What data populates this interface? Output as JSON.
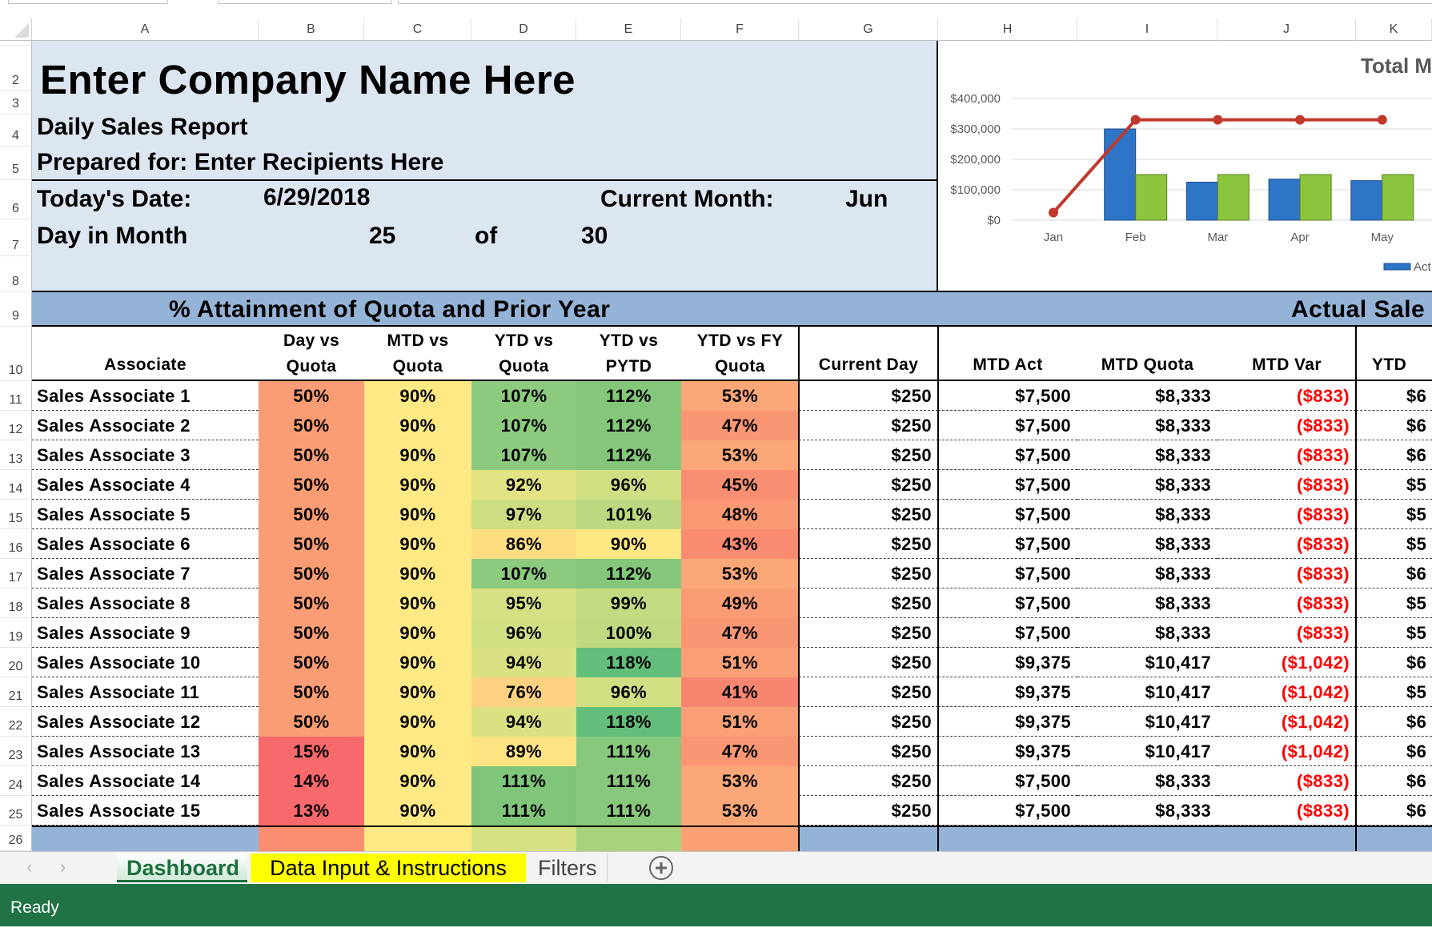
{
  "columns": [
    "A",
    "B",
    "C",
    "D",
    "E",
    "F",
    "G",
    "H",
    "I",
    "J",
    "K"
  ],
  "header": {
    "company": "Enter Company Name Here",
    "report": "Daily Sales Report",
    "prepared": "Prepared for: Enter Recipients Here",
    "date_label": "Today's Date:",
    "date_value": "6/29/2018",
    "month_label": "Current Month:",
    "month_value": "Jun",
    "day_label": "Day in Month",
    "day_value": "25",
    "of_label": "of",
    "days_total": "30"
  },
  "bands": {
    "attainment": "% Attainment of Quota and Prior Year",
    "actual": "Actual Sale"
  },
  "table_headers": {
    "associate": "Associate",
    "b": [
      "Day vs",
      "Quota"
    ],
    "c": [
      "MTD vs",
      "Quota"
    ],
    "d": [
      "YTD vs",
      "Quota"
    ],
    "e": [
      "YTD vs",
      "PYTD"
    ],
    "f": [
      "YTD vs FY",
      "Quota"
    ],
    "current_day": "Current Day",
    "mtd_act": "MTD Act",
    "mtd_quota": "MTD Quota",
    "mtd_var": "MTD Var",
    "ytd": "YTD"
  },
  "rows": [
    {
      "n": "11",
      "name": "Sales Associate 1",
      "pct": [
        "50%",
        "90%",
        "107%",
        "112%",
        "53%"
      ],
      "colors": [
        "#fa9d75",
        "#ffe984",
        "#8ccb7d",
        "#84c77b",
        "#fba777"
      ],
      "cur": "$250",
      "act": "$7,500",
      "quota": "$8,333",
      "var": "($833)",
      "ytd": "$6"
    },
    {
      "n": "12",
      "name": "Sales Associate 2",
      "pct": [
        "50%",
        "90%",
        "107%",
        "112%",
        "47%"
      ],
      "colors": [
        "#fa9d75",
        "#ffe984",
        "#8ccb7d",
        "#84c77b",
        "#fa9673"
      ],
      "cur": "$250",
      "act": "$7,500",
      "quota": "$8,333",
      "var": "($833)",
      "ytd": "$6"
    },
    {
      "n": "13",
      "name": "Sales Associate 3",
      "pct": [
        "50%",
        "90%",
        "107%",
        "112%",
        "53%"
      ],
      "colors": [
        "#fa9d75",
        "#ffe984",
        "#8ccb7d",
        "#84c77b",
        "#fba777"
      ],
      "cur": "$250",
      "act": "$7,500",
      "quota": "$8,333",
      "var": "($833)",
      "ytd": "$6"
    },
    {
      "n": "14",
      "name": "Sales Associate 4",
      "pct": [
        "50%",
        "90%",
        "92%",
        "96%",
        "45%"
      ],
      "colors": [
        "#fa9d75",
        "#ffe984",
        "#e2e383",
        "#d1df82",
        "#f98f72"
      ],
      "cur": "$250",
      "act": "$7,500",
      "quota": "$8,333",
      "var": "($833)",
      "ytd": "$5"
    },
    {
      "n": "15",
      "name": "Sales Associate 5",
      "pct": [
        "50%",
        "90%",
        "97%",
        "101%",
        "48%"
      ],
      "colors": [
        "#fa9d75",
        "#ffe984",
        "#cddd81",
        "#bcd880",
        "#fa9973"
      ],
      "cur": "$250",
      "act": "$7,500",
      "quota": "$8,333",
      "var": "($833)",
      "ytd": "$5"
    },
    {
      "n": "16",
      "name": "Sales Associate 6",
      "pct": [
        "50%",
        "90%",
        "86%",
        "90%",
        "43%"
      ],
      "colors": [
        "#fa9d75",
        "#ffe984",
        "#fedd81",
        "#fee883",
        "#f98b71"
      ],
      "cur": "$250",
      "act": "$7,500",
      "quota": "$8,333",
      "var": "($833)",
      "ytd": "$5"
    },
    {
      "n": "17",
      "name": "Sales Associate 7",
      "pct": [
        "50%",
        "90%",
        "107%",
        "112%",
        "53%"
      ],
      "colors": [
        "#fa9d75",
        "#ffe984",
        "#8ccb7d",
        "#84c77b",
        "#fba777"
      ],
      "cur": "$250",
      "act": "$7,500",
      "quota": "$8,333",
      "var": "($833)",
      "ytd": "$6"
    },
    {
      "n": "18",
      "name": "Sales Associate 8",
      "pct": [
        "50%",
        "90%",
        "95%",
        "99%",
        "49%"
      ],
      "colors": [
        "#fa9d75",
        "#ffe984",
        "#d6e082",
        "#c4da80",
        "#fa9c74"
      ],
      "cur": "$250",
      "act": "$7,500",
      "quota": "$8,333",
      "var": "($833)",
      "ytd": "$5"
    },
    {
      "n": "19",
      "name": "Sales Associate 9",
      "pct": [
        "50%",
        "90%",
        "96%",
        "100%",
        "47%"
      ],
      "colors": [
        "#fa9d75",
        "#ffe984",
        "#d1df82",
        "#c0d980",
        "#fa9673"
      ],
      "cur": "$250",
      "act": "$7,500",
      "quota": "$8,333",
      "var": "($833)",
      "ytd": "$5"
    },
    {
      "n": "20",
      "name": "Sales Associate 10",
      "pct": [
        "50%",
        "90%",
        "94%",
        "118%",
        "51%"
      ],
      "colors": [
        "#fa9d75",
        "#ffe984",
        "#dae182",
        "#63be7b",
        "#fba076"
      ],
      "cur": "$250",
      "act": "$9,375",
      "quota": "$10,417",
      "var": "($1,042)",
      "ytd": "$6"
    },
    {
      "n": "21",
      "name": "Sales Associate 11",
      "pct": [
        "50%",
        "90%",
        "76%",
        "96%",
        "41%"
      ],
      "colors": [
        "#fa9d75",
        "#ffe984",
        "#fed280",
        "#d1df82",
        "#f88570"
      ],
      "cur": "$250",
      "act": "$9,375",
      "quota": "$10,417",
      "var": "($1,042)",
      "ytd": "$5"
    },
    {
      "n": "22",
      "name": "Sales Associate 12",
      "pct": [
        "50%",
        "90%",
        "94%",
        "118%",
        "51%"
      ],
      "colors": [
        "#fa9d75",
        "#ffe984",
        "#dae182",
        "#63be7b",
        "#fba076"
      ],
      "cur": "$250",
      "act": "$9,375",
      "quota": "$10,417",
      "var": "($1,042)",
      "ytd": "$6"
    },
    {
      "n": "23",
      "name": "Sales Associate 13",
      "pct": [
        "15%",
        "90%",
        "89%",
        "111%",
        "47%"
      ],
      "colors": [
        "#f8696b",
        "#ffe984",
        "#fee382",
        "#88c87c",
        "#fa9673"
      ],
      "cur": "$250",
      "act": "$9,375",
      "quota": "$10,417",
      "var": "($1,042)",
      "ytd": "$6"
    },
    {
      "n": "24",
      "name": "Sales Associate 14",
      "pct": [
        "14%",
        "90%",
        "111%",
        "111%",
        "53%"
      ],
      "colors": [
        "#f8696b",
        "#ffe984",
        "#7fc57a",
        "#88c87c",
        "#fba777"
      ],
      "cur": "$250",
      "act": "$7,500",
      "quota": "$8,333",
      "var": "($833)",
      "ytd": "$6"
    },
    {
      "n": "25",
      "name": "Sales Associate 15",
      "pct": [
        "13%",
        "90%",
        "111%",
        "111%",
        "53%"
      ],
      "colors": [
        "#f8696b",
        "#ffe984",
        "#7fc57a",
        "#88c87c",
        "#fba777"
      ],
      "cur": "$250",
      "act": "$7,500",
      "quota": "$8,333",
      "var": "($833)",
      "ytd": "$6"
    }
  ],
  "total_row_colors": [
    "#f98d70",
    "#ffe984",
    "#d6e082",
    "#a8d27e",
    "#fba174"
  ],
  "colors": {
    "header_bg": "#dce6f1",
    "band": "#95b3d7",
    "negative": "#ff0000",
    "status_bar": "#217346",
    "active_tab": "#1e6f3e",
    "highlight_tab": "#ffff00"
  },
  "chart_data": {
    "type": "bar",
    "title": "Total M",
    "categories": [
      "Jan",
      "Feb",
      "Mar",
      "Apr",
      "May"
    ],
    "yticks": [
      "$0",
      "$100,000",
      "$200,000",
      "$300,000",
      "$400,000"
    ],
    "ylim": [
      0,
      400000
    ],
    "series": [
      {
        "name": "Act",
        "type": "bar",
        "color": "#2e75c8",
        "values": [
          0,
          300000,
          125000,
          135000,
          130000
        ]
      },
      {
        "type": "bar",
        "color": "#8cc63f",
        "values": [
          0,
          150000,
          150000,
          150000,
          150000
        ]
      },
      {
        "type": "line",
        "color": "#c0392b",
        "values": [
          25000,
          330000,
          330000,
          330000,
          330000
        ]
      }
    ],
    "legend": "bottom-right",
    "grid": true
  },
  "tabs": [
    {
      "label": "Dashboard"
    },
    {
      "label": "Data Input & Instructions"
    },
    {
      "label": "Filters"
    }
  ],
  "status": "Ready"
}
